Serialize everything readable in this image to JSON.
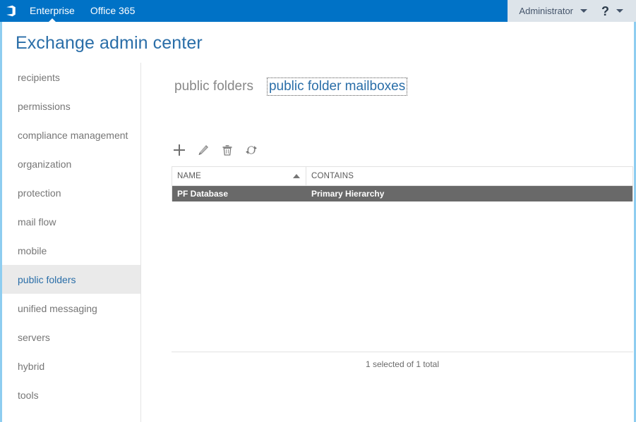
{
  "suite_bar": {
    "app_launcher_icon": "office-waffle-icon",
    "links": [
      {
        "label": "Enterprise",
        "active": true
      },
      {
        "label": "Office 365",
        "active": false
      }
    ],
    "user": "Administrator",
    "user_caret_icon": "chevron-down-icon",
    "help_glyph": "?",
    "help_caret_icon": "chevron-down-icon",
    "accent_color": "#0072c6",
    "right_bg_color": "#dde4ea"
  },
  "header": {
    "title": "Exchange admin center",
    "title_color": "#2a6ea8"
  },
  "sidebar": {
    "items": [
      {
        "label": "recipients",
        "selected": false
      },
      {
        "label": "permissions",
        "selected": false
      },
      {
        "label": "compliance management",
        "selected": false
      },
      {
        "label": "organization",
        "selected": false
      },
      {
        "label": "protection",
        "selected": false
      },
      {
        "label": "mail flow",
        "selected": false
      },
      {
        "label": "mobile",
        "selected": false
      },
      {
        "label": "public folders",
        "selected": true
      },
      {
        "label": "unified messaging",
        "selected": false
      },
      {
        "label": "servers",
        "selected": false
      },
      {
        "label": "hybrid",
        "selected": false
      },
      {
        "label": "tools",
        "selected": false
      }
    ],
    "selected_accent_color": "#8ecdf0",
    "selected_bg_color": "#eaeaea"
  },
  "main": {
    "tabs": [
      {
        "label": "public folders",
        "active": false
      },
      {
        "label": "public folder mailboxes",
        "active": true
      }
    ],
    "toolbar": [
      {
        "name": "add-button",
        "icon": "plus-icon",
        "title": "Add"
      },
      {
        "name": "edit-button",
        "icon": "pencil-icon",
        "title": "Edit"
      },
      {
        "name": "delete-button",
        "icon": "trash-icon",
        "title": "Delete"
      },
      {
        "name": "refresh-button",
        "icon": "refresh-icon",
        "title": "Refresh"
      }
    ],
    "table": {
      "columns": [
        {
          "label": "NAME",
          "sort": "asc"
        },
        {
          "label": "CONTAINS",
          "sort": null
        }
      ],
      "rows": [
        {
          "name": "PF Database",
          "contains": "Primary Hierarchy",
          "selected": true
        }
      ],
      "selected_row_bg": "#696969"
    },
    "footer_status": "1 selected of 1 total"
  }
}
